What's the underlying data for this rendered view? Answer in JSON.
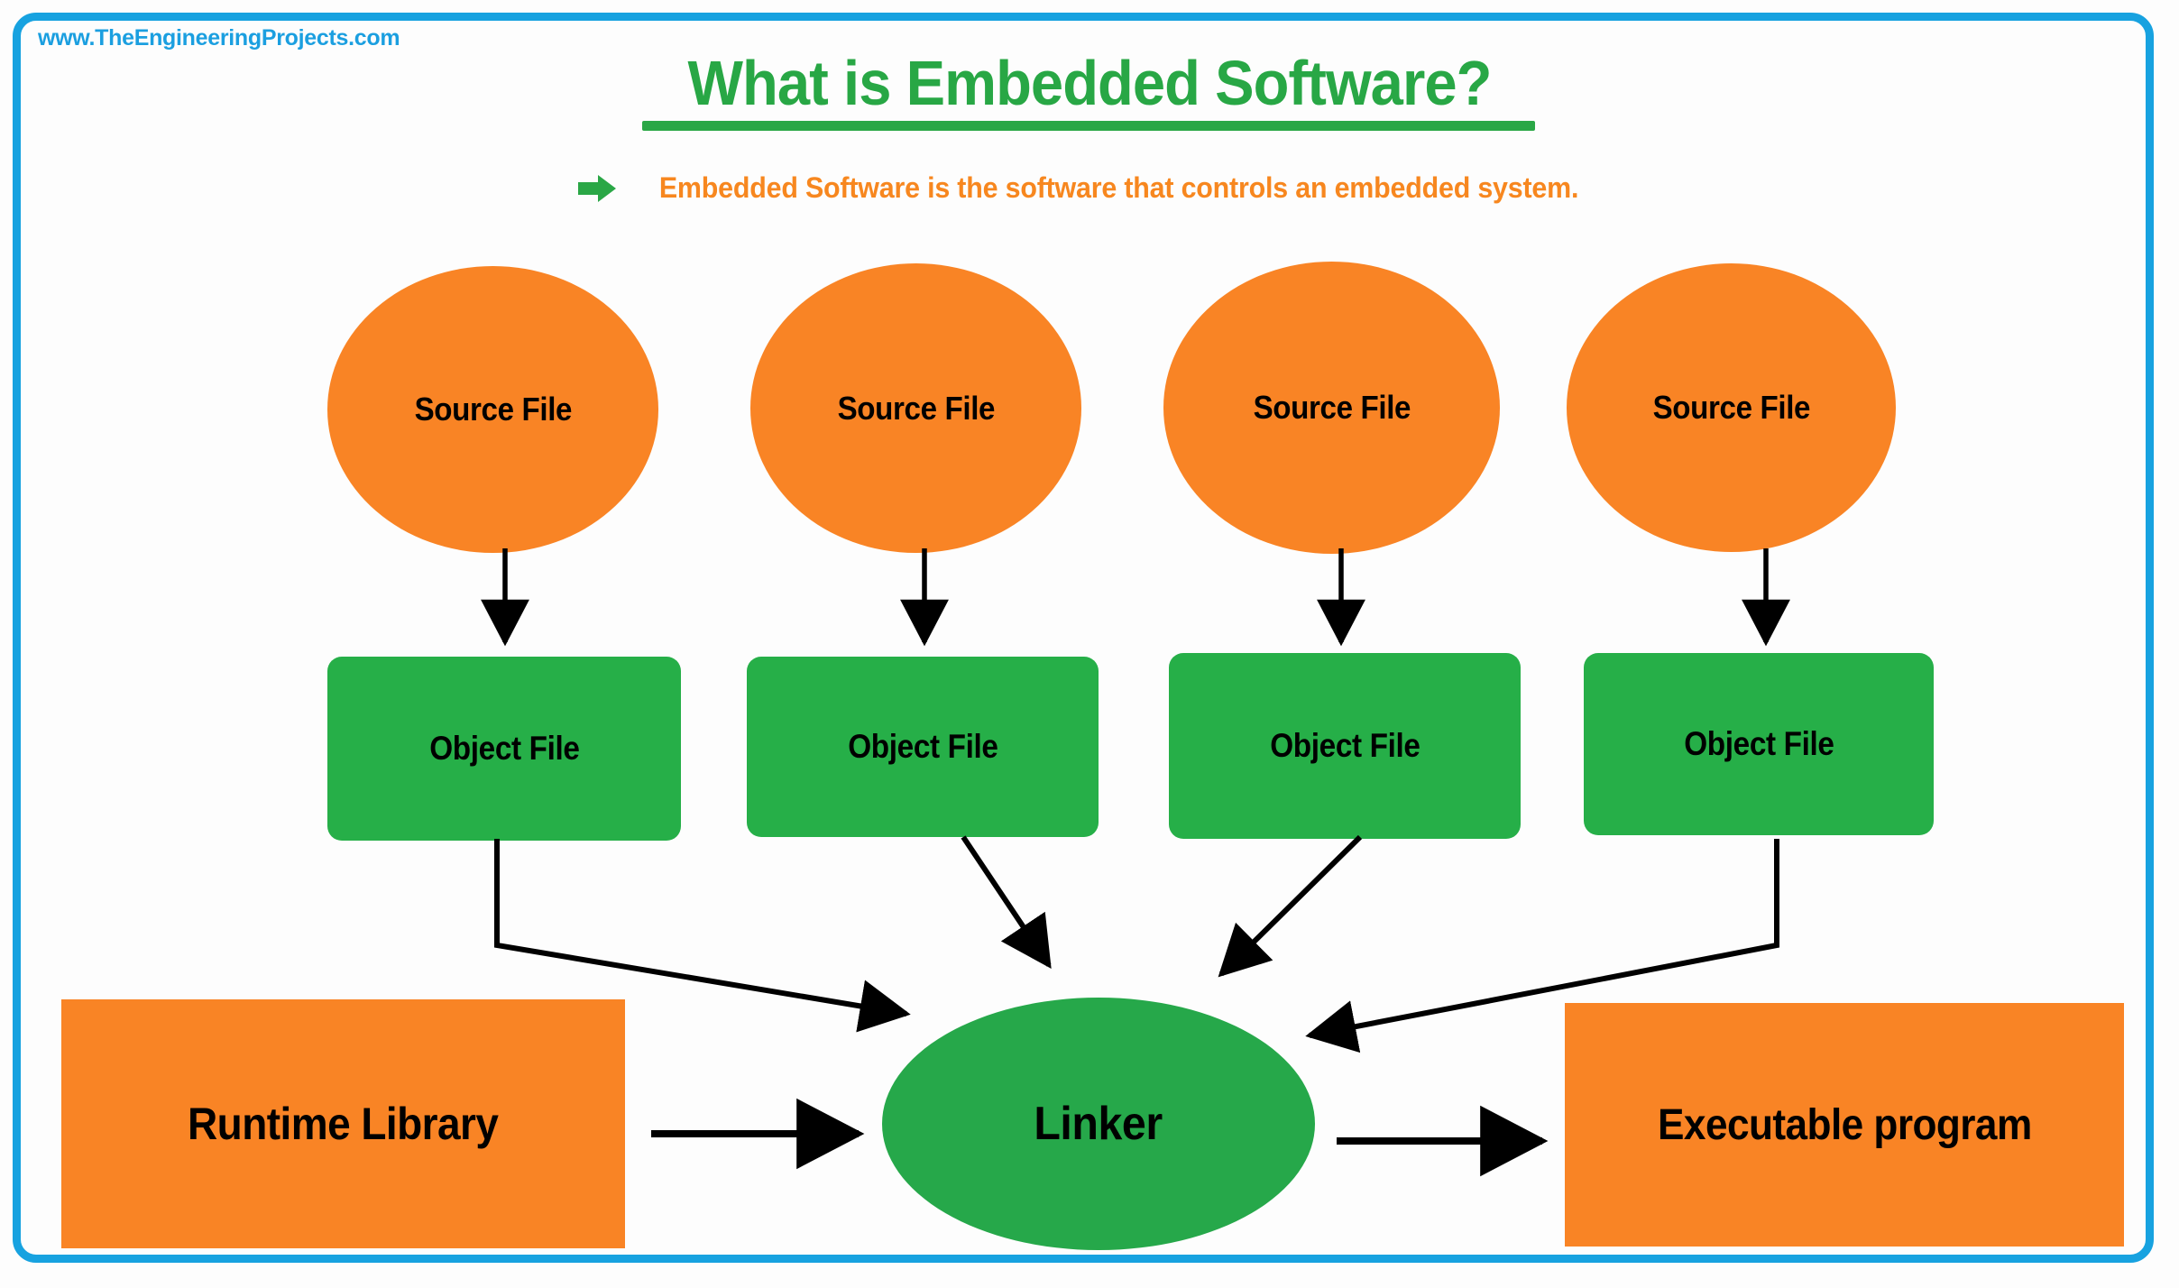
{
  "branding": {
    "site_url": "www.TheEngineeringProjects.com",
    "url_color": "#1b9fe0",
    "frame_color": "#17a2e0"
  },
  "header": {
    "title": "What is Embedded Software?",
    "title_color": "#28a745",
    "underline_color": "#2aa746",
    "subtitle": "Embedded Software is the software that controls an embedded system.",
    "subtitle_color": "#f7871f",
    "bullet_icon": "green-right-arrow-icon",
    "bullet_color": "#2aa746"
  },
  "palette": {
    "orange": "#f98425",
    "green": "#26af48",
    "linker_green": "#26a84a",
    "black": "#000000",
    "background": "#fdfdfd"
  },
  "diagram": {
    "type": "flowchart",
    "source_files": [
      {
        "label": "Source File",
        "shape": "ellipse",
        "color": "#f98425"
      },
      {
        "label": "Source File",
        "shape": "ellipse",
        "color": "#f98425"
      },
      {
        "label": "Source File",
        "shape": "ellipse",
        "color": "#f98425"
      },
      {
        "label": "Source File",
        "shape": "ellipse",
        "color": "#f98425"
      }
    ],
    "object_files": [
      {
        "label": "Object File",
        "shape": "rounded-rectangle",
        "color": "#26af48"
      },
      {
        "label": "Object File",
        "shape": "rounded-rectangle",
        "color": "#26af48"
      },
      {
        "label": "Object File",
        "shape": "rounded-rectangle",
        "color": "#26af48"
      },
      {
        "label": "Object File",
        "shape": "rounded-rectangle",
        "color": "#26af48"
      }
    ],
    "linker": {
      "label": "Linker",
      "shape": "ellipse",
      "color": "#26a84a"
    },
    "runtime_library": {
      "label": "Runtime Library",
      "shape": "rectangle",
      "color": "#f98425"
    },
    "executable_program": {
      "label": "Executable program",
      "shape": "rectangle",
      "color": "#f98425"
    },
    "edges": [
      {
        "from": "Source File 1",
        "to": "Object File 1",
        "style": "straight-arrow"
      },
      {
        "from": "Source File 2",
        "to": "Object File 2",
        "style": "straight-arrow"
      },
      {
        "from": "Source File 3",
        "to": "Object File 3",
        "style": "straight-arrow"
      },
      {
        "from": "Source File 4",
        "to": "Object File 4",
        "style": "straight-arrow"
      },
      {
        "from": "Object File 1",
        "to": "Linker",
        "style": "elbow-arrow"
      },
      {
        "from": "Object File 2",
        "to": "Linker",
        "style": "diagonal-arrow"
      },
      {
        "from": "Object File 3",
        "to": "Linker",
        "style": "diagonal-arrow"
      },
      {
        "from": "Object File 4",
        "to": "Linker",
        "style": "elbow-arrow"
      },
      {
        "from": "Runtime Library",
        "to": "Linker",
        "style": "straight-arrow"
      },
      {
        "from": "Linker",
        "to": "Executable program",
        "style": "straight-arrow"
      }
    ]
  }
}
